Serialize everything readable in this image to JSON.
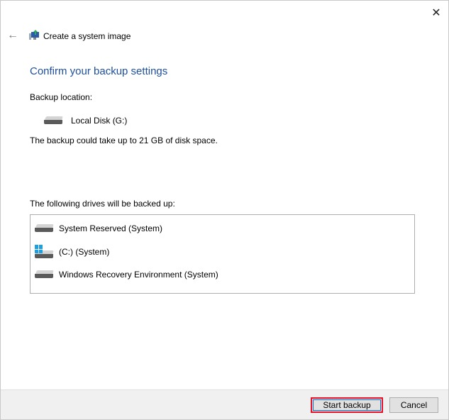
{
  "window": {
    "title": "Create a system image"
  },
  "heading": "Confirm your backup settings",
  "backup_location_label": "Backup location:",
  "backup_location": "Local Disk (G:)",
  "space_note": "The backup could take up to 21 GB of disk space.",
  "drives_label": "The following drives will be backed up:",
  "drives": [
    {
      "name": "System Reserved (System)",
      "icon": "drive-icon"
    },
    {
      "name": "(C:) (System)",
      "icon": "windows-drive-icon"
    },
    {
      "name": "Windows Recovery Environment (System)",
      "icon": "drive-icon"
    }
  ],
  "buttons": {
    "start": "Start backup",
    "cancel": "Cancel"
  },
  "colors": {
    "heading": "#1e4fa0",
    "highlight": "#e81123"
  }
}
